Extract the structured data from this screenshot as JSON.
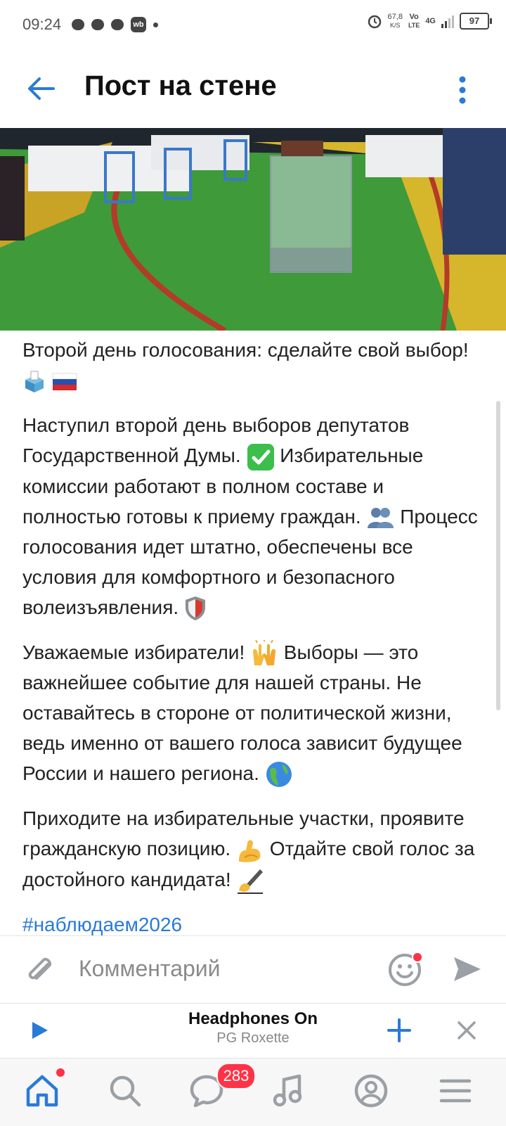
{
  "status_bar": {
    "time": "09:24",
    "speed_value": "67,8",
    "speed_unit": "K/S",
    "net_top": "Vo",
    "net_bottom": "LTE",
    "net_type": "4G",
    "battery": "97"
  },
  "header": {
    "title": "Пост на стене"
  },
  "post": {
    "paragraphs": [
      "Второй день голосования: сделайте свой выбор!",
      "Наступил второй день выборов депутатов Государственной Думы.",
      "Избирательные комиссии работают в полном составе и полностью готовы к приему граждан.",
      "Процесс голосования идет штатно, обеспечены все условия для комфортного и безопасного волеизъявления.",
      "Уважаемые избиратели!",
      "Выборы — это важнейшее событие для нашей страны. Не оставайтесь в стороне от политической жизни, ведь именно от вашего голоса зависит будущее России и нашего региона.",
      "Приходите на избирательные участки, проявите гражданскую позицию.",
      "Отдайте свой голос за достойного кандидата!"
    ],
    "hashtag": "#наблюдаем2026"
  },
  "comment_bar": {
    "placeholder": "Комментарий"
  },
  "player": {
    "title": "Headphones On",
    "artist": "PG Roxette"
  },
  "bottom_nav": {
    "messages_badge": "283"
  },
  "colors": {
    "accent": "#2a7ad8",
    "badge": "#ff3347"
  }
}
